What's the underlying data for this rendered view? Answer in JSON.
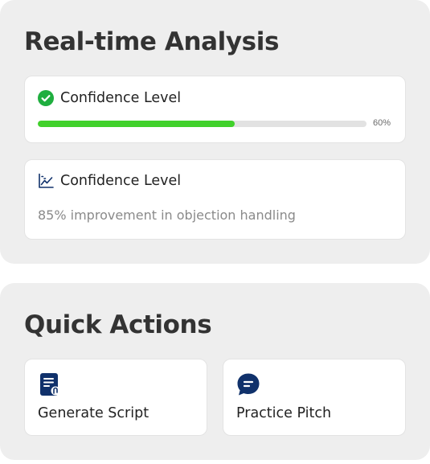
{
  "analysis": {
    "title": "Real-time Analysis",
    "confidence_card": {
      "label": "Confidence Level",
      "icon": "check-circle-icon",
      "progress": 0.6,
      "progress_text": "60%",
      "color": "#41d12b"
    },
    "insight_card": {
      "label": "Confidence Level",
      "icon": "line-chart-icon",
      "text": "85% improvement in objection handling"
    }
  },
  "quick_actions": {
    "title": "Quick Actions",
    "items": [
      {
        "label": "Generate Script",
        "icon": "script-document-icon"
      },
      {
        "label": "Practice Pitch",
        "icon": "chat-bubble-icon"
      }
    ],
    "icon_color": "#10316b"
  }
}
